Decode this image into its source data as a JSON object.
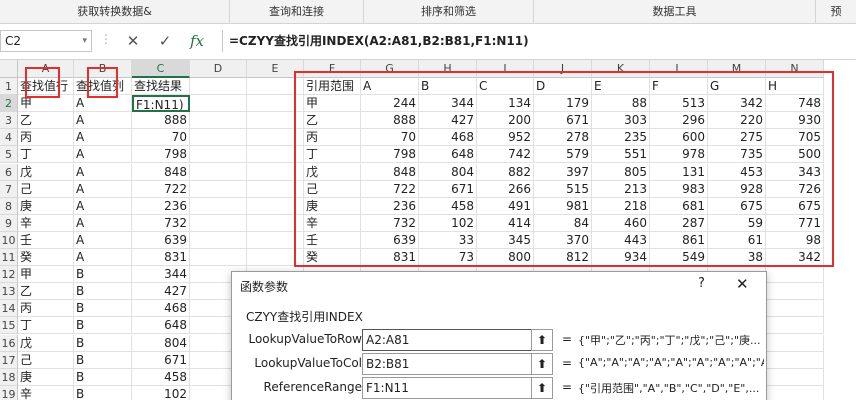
{
  "ribbon": {
    "groups": [
      "获取转换数据&",
      "查询和连接",
      "排序和筛选",
      "数据工具",
      "预"
    ]
  },
  "formula_bar": {
    "name_box": "C2",
    "dropdown_glyph": "▾",
    "separator": "⋮",
    "cancel_glyph": "✕",
    "confirm_glyph": "✓",
    "fx_label": "fx",
    "formula": "=CZYY查找引用INDEX(A2:A81,B2:B81,F1:N11)"
  },
  "columns": [
    "A",
    "B",
    "C",
    "D",
    "E",
    "F",
    "G",
    "H",
    "I",
    "J",
    "K",
    "L",
    "M",
    "N"
  ],
  "row_numbers": [
    "1",
    "2",
    "3",
    "4",
    "5",
    "6",
    "7",
    "8",
    "9",
    "10",
    "11",
    "12",
    "13",
    "14",
    "15",
    "16",
    "17",
    "18",
    "19"
  ],
  "left_table": {
    "headers": [
      "查找值行",
      "查找值列",
      "查找结果"
    ],
    "active_cell_text": "F1:N11)",
    "rows": [
      [
        "甲",
        "A",
        "F1:N11)"
      ],
      [
        "乙",
        "A",
        "888"
      ],
      [
        "丙",
        "A",
        "70"
      ],
      [
        "丁",
        "A",
        "798"
      ],
      [
        "戊",
        "A",
        "848"
      ],
      [
        "己",
        "A",
        "722"
      ],
      [
        "庚",
        "A",
        "236"
      ],
      [
        "辛",
        "A",
        "732"
      ],
      [
        "壬",
        "A",
        "639"
      ],
      [
        "癸",
        "A",
        "831"
      ],
      [
        "甲",
        "B",
        "344"
      ],
      [
        "乙",
        "B",
        "427"
      ],
      [
        "丙",
        "B",
        "468"
      ],
      [
        "丁",
        "B",
        "648"
      ],
      [
        "戊",
        "B",
        "804"
      ],
      [
        "己",
        "B",
        "671"
      ],
      [
        "庚",
        "B",
        "458"
      ],
      [
        "辛",
        "B",
        "102"
      ]
    ]
  },
  "ref_table": {
    "header": [
      "引用范围",
      "A",
      "B",
      "C",
      "D",
      "E",
      "F",
      "G",
      "H"
    ],
    "rows": [
      [
        "甲",
        "244",
        "344",
        "134",
        "179",
        "88",
        "513",
        "342",
        "748"
      ],
      [
        "乙",
        "888",
        "427",
        "200",
        "671",
        "303",
        "296",
        "220",
        "930"
      ],
      [
        "丙",
        "70",
        "468",
        "952",
        "278",
        "235",
        "600",
        "275",
        "705"
      ],
      [
        "丁",
        "798",
        "648",
        "742",
        "579",
        "551",
        "978",
        "735",
        "500"
      ],
      [
        "戊",
        "848",
        "804",
        "882",
        "397",
        "805",
        "131",
        "453",
        "343"
      ],
      [
        "己",
        "722",
        "671",
        "266",
        "515",
        "213",
        "983",
        "928",
        "726"
      ],
      [
        "庚",
        "236",
        "458",
        "491",
        "981",
        "218",
        "681",
        "675",
        "675"
      ],
      [
        "辛",
        "732",
        "102",
        "414",
        "84",
        "460",
        "287",
        "59",
        "771"
      ],
      [
        "壬",
        "639",
        "33",
        "345",
        "370",
        "443",
        "861",
        "61",
        "98"
      ],
      [
        "癸",
        "831",
        "73",
        "800",
        "812",
        "934",
        "549",
        "38",
        "342"
      ]
    ]
  },
  "dialog": {
    "title": "函数参数",
    "help": "?",
    "close": "✕",
    "function_name": "CZYY查找引用INDEX",
    "args": [
      {
        "label": "LookupValueToRow",
        "value": "A2:A81",
        "preview": "{\"甲\";\"乙\";\"丙\";\"丁\";\"戊\";\"己\";\"庚..."
      },
      {
        "label": "LookupValueToCol",
        "value": "B2:B81",
        "preview": "{\"A\";\"A\";\"A\";\"A\";\"A\";\"A\";\"A\";\"A\";\"A..."
      },
      {
        "label": "ReferenceRange",
        "value": "F1:N11",
        "preview": "{\"引用范围\",\"A\",\"B\",\"C\",\"D\",\"E\",..."
      }
    ],
    "collapse_glyph": "⬆",
    "equals": "="
  },
  "colors": {
    "highlight_red": "#e52d2d",
    "excel_green": "#217346"
  }
}
